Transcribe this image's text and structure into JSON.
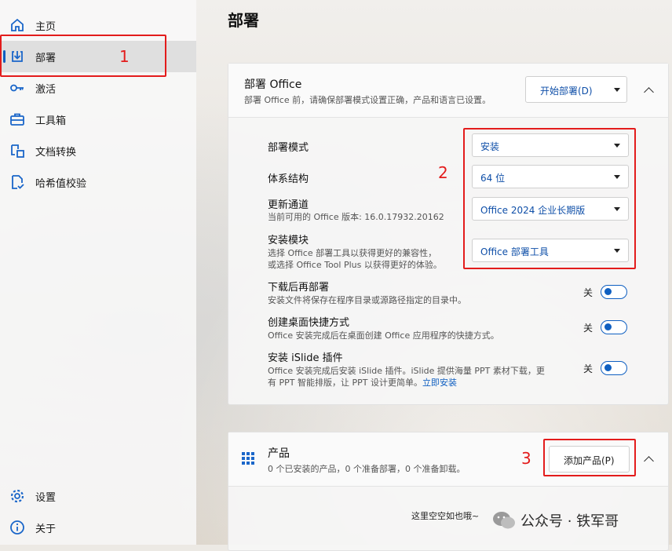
{
  "sidebar": {
    "items": [
      {
        "label": "主页",
        "icon": "home-icon"
      },
      {
        "label": "部署",
        "icon": "deploy-icon",
        "active": true
      },
      {
        "label": "激活",
        "icon": "key-icon"
      },
      {
        "label": "工具箱",
        "icon": "toolbox-icon"
      },
      {
        "label": "文档转换",
        "icon": "convert-icon"
      },
      {
        "label": "哈希值校验",
        "icon": "hash-check-icon"
      }
    ],
    "bottom": [
      {
        "label": "设置",
        "icon": "gear-icon"
      },
      {
        "label": "关于",
        "icon": "info-icon"
      }
    ]
  },
  "page": {
    "title": "部署"
  },
  "deploy_card": {
    "title": "部署 Office",
    "desc": "部署 Office 前，请确保部署模式设置正确，产品和语言已设置。",
    "start_button": "开始部署(D)",
    "rows": {
      "mode": {
        "title": "部署模式",
        "value": "安装"
      },
      "arch": {
        "title": "体系结构",
        "value": "64 位"
      },
      "channel": {
        "title": "更新通道",
        "desc": "当前可用的 Office 版本: 16.0.17932.20162",
        "value": "Office 2024 企业长期版"
      },
      "module": {
        "title": "安装模块",
        "desc1": "选择 Office 部署工具以获得更好的兼容性，",
        "desc2": "或选择 Office Tool Plus 以获得更好的体验。",
        "value": "Office 部署工具"
      },
      "download_first": {
        "title": "下载后再部署",
        "desc": "安装文件将保存在程序目录或源路径指定的目录中。",
        "state": "关"
      },
      "shortcut": {
        "title": "创建桌面快捷方式",
        "desc": "Office 安装完成后在桌面创建 Office 应用程序的快捷方式。",
        "state": "关"
      },
      "islide": {
        "title": "安装 iSlide 插件",
        "desc1": "Office 安装完成后安装 iSlide 插件。iSlide 提供海量 PPT 素材下载，更",
        "desc2": "有 PPT 智能排版，让 PPT 设计更简单。",
        "link": "立即安装",
        "state": "关"
      }
    }
  },
  "product_card": {
    "title": "产品",
    "desc": "0 个已安装的产品，0 个准备部署，0 个准备卸载。",
    "add_button": "添加产品(P)",
    "empty_text": "这里空空如也哦~"
  },
  "annotations": {
    "n1": "1",
    "n2": "2",
    "n3": "3"
  },
  "watermark": "公众号 · 铁军哥",
  "colors": {
    "accent": "#0f5fc1",
    "annotation": "#e31c1c"
  }
}
